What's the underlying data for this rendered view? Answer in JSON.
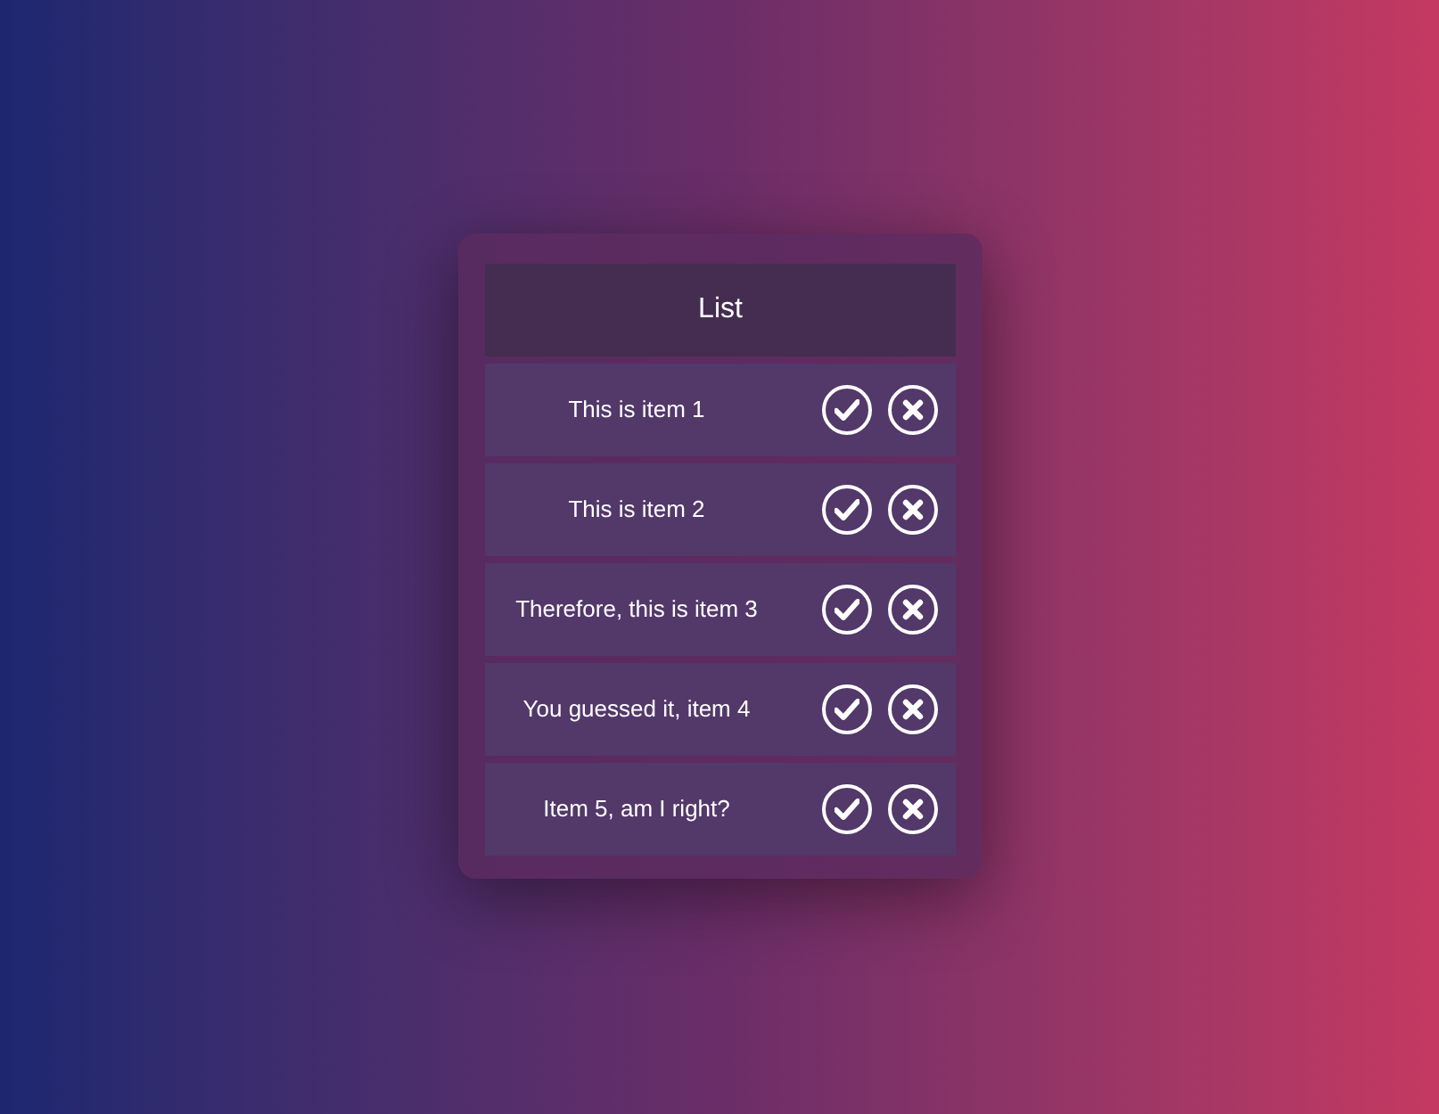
{
  "title": "List",
  "items": [
    {
      "text": "This is item 1"
    },
    {
      "text": "This is item 2"
    },
    {
      "text": "Therefore, this is item 3"
    },
    {
      "text": "You guessed it, item 4"
    },
    {
      "text": "Item 5, am I right?"
    }
  ]
}
